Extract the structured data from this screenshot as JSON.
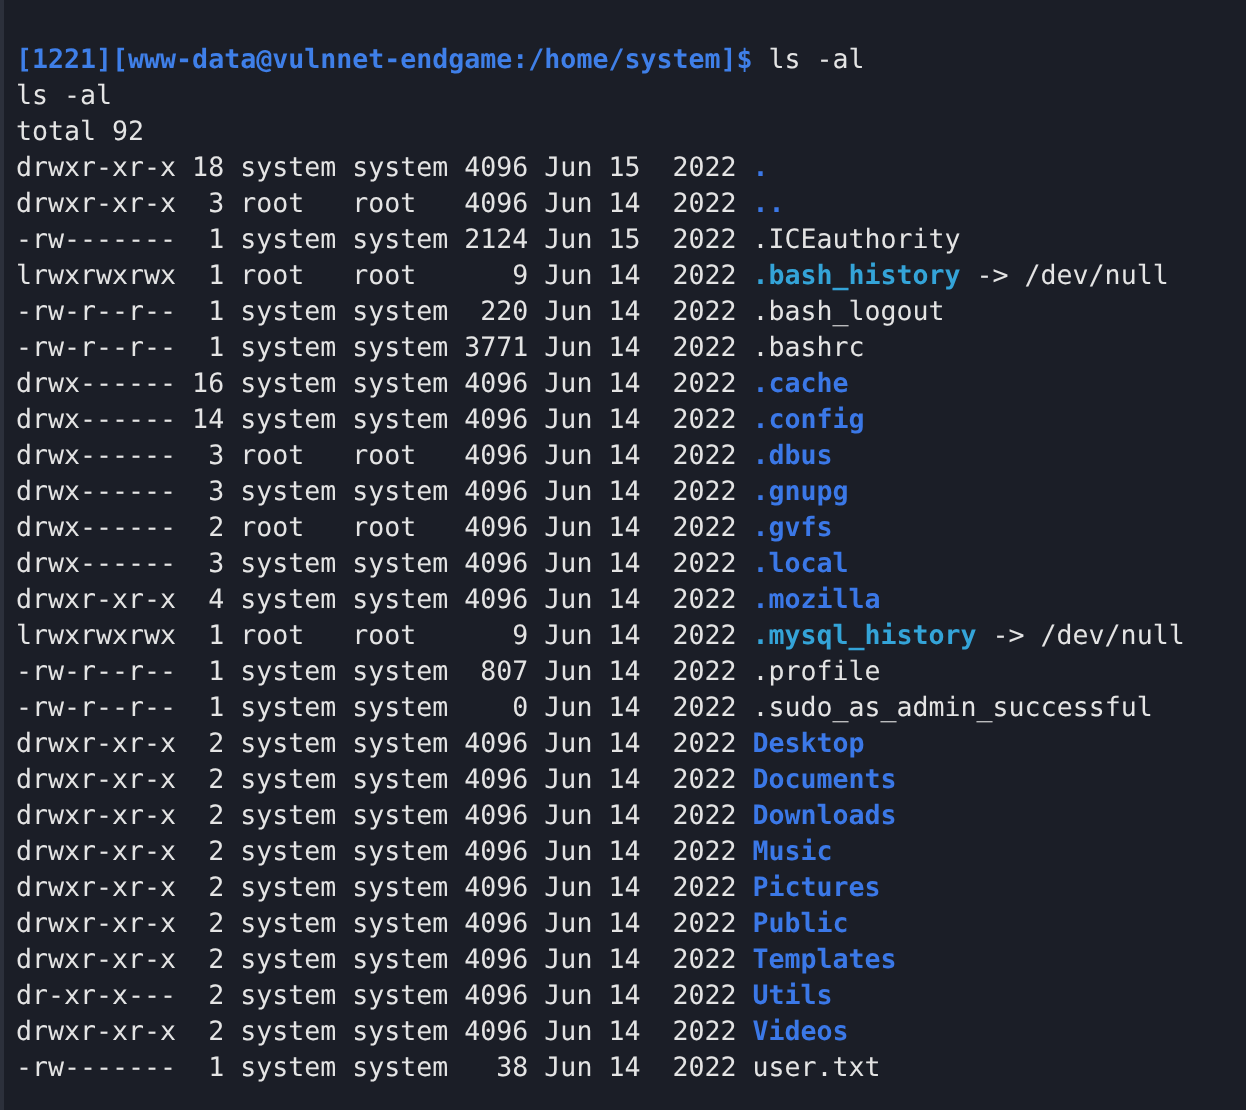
{
  "prompt": {
    "text": "[1221][www-data@vulnnet-endgame:/home/system]$",
    "command": "ls -al"
  },
  "output_lines": [
    "ls -al",
    "total 92"
  ],
  "entries": [
    {
      "meta": "drwxr-xr-x 18 system system 4096 Jun 15  2022",
      "name": ".",
      "kind": "dir"
    },
    {
      "meta": "drwxr-xr-x  3 root   root   4096 Jun 14  2022",
      "name": "..",
      "kind": "dir"
    },
    {
      "meta": "-rw-------  1 system system 2124 Jun 15  2022",
      "name": ".ICEauthority",
      "kind": "file"
    },
    {
      "meta": "lrwxrwxrwx  1 root   root      9 Jun 14  2022",
      "name": ".bash_history",
      "kind": "link",
      "target": "-> /dev/null"
    },
    {
      "meta": "-rw-r--r--  1 system system  220 Jun 14  2022",
      "name": ".bash_logout",
      "kind": "file"
    },
    {
      "meta": "-rw-r--r--  1 system system 3771 Jun 14  2022",
      "name": ".bashrc",
      "kind": "file"
    },
    {
      "meta": "drwx------ 16 system system 4096 Jun 14  2022",
      "name": ".cache",
      "kind": "dir"
    },
    {
      "meta": "drwx------ 14 system system 4096 Jun 14  2022",
      "name": ".config",
      "kind": "dir"
    },
    {
      "meta": "drwx------  3 root   root   4096 Jun 14  2022",
      "name": ".dbus",
      "kind": "dir"
    },
    {
      "meta": "drwx------  3 system system 4096 Jun 14  2022",
      "name": ".gnupg",
      "kind": "dir"
    },
    {
      "meta": "drwx------  2 root   root   4096 Jun 14  2022",
      "name": ".gvfs",
      "kind": "dir"
    },
    {
      "meta": "drwx------  3 system system 4096 Jun 14  2022",
      "name": ".local",
      "kind": "dir"
    },
    {
      "meta": "drwxr-xr-x  4 system system 4096 Jun 14  2022",
      "name": ".mozilla",
      "kind": "dir"
    },
    {
      "meta": "lrwxrwxrwx  1 root   root      9 Jun 14  2022",
      "name": ".mysql_history",
      "kind": "link",
      "target": "-> /dev/null"
    },
    {
      "meta": "-rw-r--r--  1 system system  807 Jun 14  2022",
      "name": ".profile",
      "kind": "file"
    },
    {
      "meta": "-rw-r--r--  1 system system    0 Jun 14  2022",
      "name": ".sudo_as_admin_successful",
      "kind": "file"
    },
    {
      "meta": "drwxr-xr-x  2 system system 4096 Jun 14  2022",
      "name": "Desktop",
      "kind": "dir"
    },
    {
      "meta": "drwxr-xr-x  2 system system 4096 Jun 14  2022",
      "name": "Documents",
      "kind": "dir"
    },
    {
      "meta": "drwxr-xr-x  2 system system 4096 Jun 14  2022",
      "name": "Downloads",
      "kind": "dir"
    },
    {
      "meta": "drwxr-xr-x  2 system system 4096 Jun 14  2022",
      "name": "Music",
      "kind": "dir"
    },
    {
      "meta": "drwxr-xr-x  2 system system 4096 Jun 14  2022",
      "name": "Pictures",
      "kind": "dir"
    },
    {
      "meta": "drwxr-xr-x  2 system system 4096 Jun 14  2022",
      "name": "Public",
      "kind": "dir"
    },
    {
      "meta": "drwxr-xr-x  2 system system 4096 Jun 14  2022",
      "name": "Templates",
      "kind": "dir"
    },
    {
      "meta": "dr-xr-x---  2 system system 4096 Jun 14  2022",
      "name": "Utils",
      "kind": "dir"
    },
    {
      "meta": "drwxr-xr-x  2 system system 4096 Jun 14  2022",
      "name": "Videos",
      "kind": "dir"
    },
    {
      "meta": "-rw-------  1 system system   38 Jun 14  2022",
      "name": "user.txt",
      "kind": "file"
    }
  ]
}
